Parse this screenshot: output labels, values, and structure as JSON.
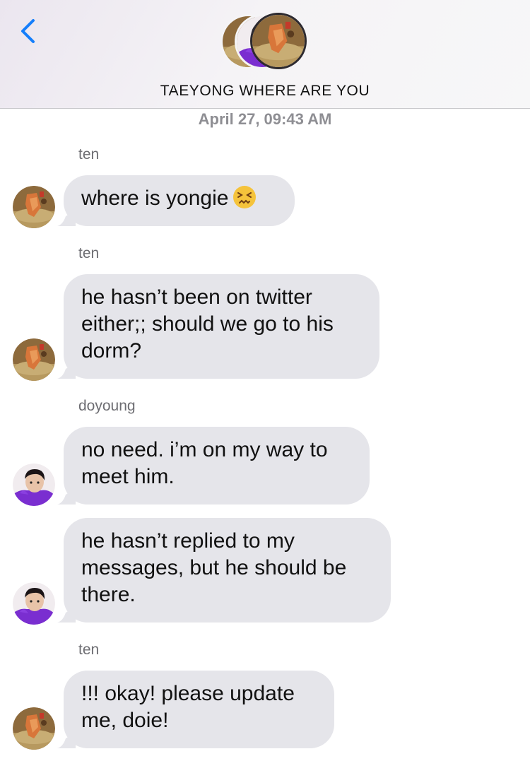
{
  "header": {
    "back_icon": "chevron-left-icon",
    "title": "TAEYONG WHERE ARE YOU"
  },
  "timestamp": "April 27, 09:43 AM",
  "messages": [
    {
      "sender": "ten",
      "text": "where is yongie",
      "emoji": "confounded-face-icon"
    },
    {
      "sender": "ten",
      "text": "he hasn’t been on twitter either;; should we go to his dorm?"
    },
    {
      "sender": "doyoung",
      "text": "no need. i’m on my way to meet him."
    },
    {
      "sender": "",
      "text": "he hasn’t replied to my messages, but he should be there."
    },
    {
      "sender": "ten",
      "text": "!!! okay! please update me, doie!"
    }
  ],
  "colors": {
    "accent": "#147efb",
    "bubble": "#e5e5ea",
    "sender_label": "#6d6d72",
    "timestamp": "#8e8e93"
  }
}
